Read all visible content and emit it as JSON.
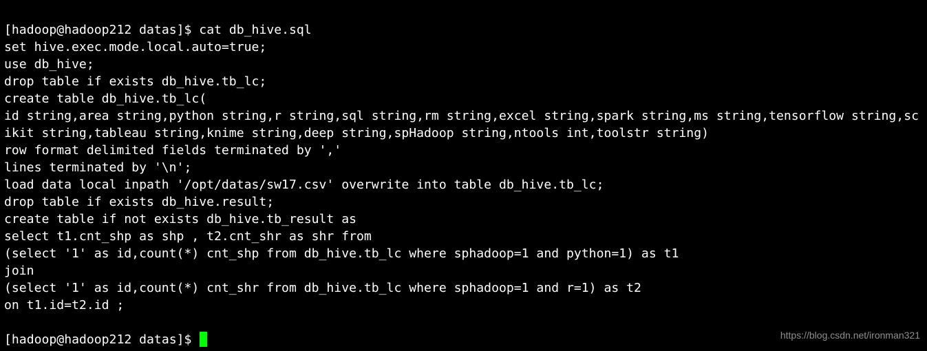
{
  "prompt1": {
    "open": "[",
    "user": "hadoop",
    "at": "@",
    "host": "hadoop212",
    "space": " ",
    "path": "datas",
    "close": "]$ ",
    "command": "cat db_hive.sql"
  },
  "file_lines": [
    "set hive.exec.mode.local.auto=true;",
    "use db_hive;",
    "drop table if exists db_hive.tb_lc;",
    "create table db_hive.tb_lc(",
    "id string,area string,python string,r string,sql string,rm string,excel string,spark string,ms string,tensorflow string,scikit string,tableau string,knime string,deep string,spHadoop string,ntools int,toolstr string)",
    "row format delimited fields terminated by ','",
    "lines terminated by '\\n';",
    "load data local inpath '/opt/datas/sw17.csv' overwrite into table db_hive.tb_lc;",
    "drop table if exists db_hive.result;",
    "create table if not exists db_hive.tb_result as",
    "select t1.cnt_shp as shp , t2.cnt_shr as shr from",
    "(select '1' as id,count(*) cnt_shp from db_hive.tb_lc where sphadoop=1 and python=1) as t1",
    "join",
    "(select '1' as id,count(*) cnt_shr from db_hive.tb_lc where sphadoop=1 and r=1) as t2",
    "on t1.id=t2.id ;",
    ""
  ],
  "prompt2": {
    "open": "[",
    "user": "hadoop",
    "at": "@",
    "host": "hadoop212",
    "space": " ",
    "path": "datas",
    "close": "]$ "
  },
  "watermark": "https://blog.csdn.net/ironman321"
}
